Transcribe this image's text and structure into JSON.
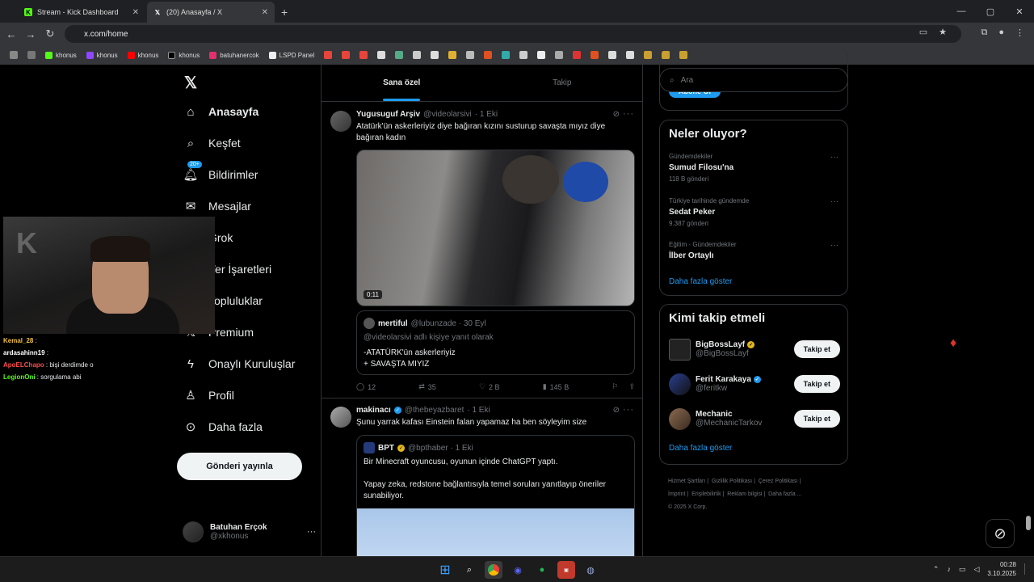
{
  "browser": {
    "tabs": [
      {
        "title": "Stream - Kick Dashboard",
        "icon": "kick-icon",
        "active": false
      },
      {
        "title": "(20) Anasayfa / X",
        "icon": "x-icon",
        "active": true
      }
    ],
    "url": "x.com/home",
    "bookmarks": [
      "khonus",
      "khonus",
      "khonus",
      "khonus",
      "batuhanercok",
      "LSPD Panel"
    ]
  },
  "leftnav": {
    "items": [
      "Anasayfa",
      "Keşfet",
      "Bildirimler",
      "Mesajlar",
      "Grok",
      "Yer İşaretleri",
      "Topluluklar",
      "Premium",
      "Onaylı Kuruluşlar",
      "Profil",
      "Daha fazla"
    ],
    "notif_badge": "20+",
    "post_button": "Gönderi yayınla",
    "me_name": "Batuhan Erçok",
    "me_handle": "@xkhonus"
  },
  "chat": [
    {
      "user": "Kemal_28",
      "msg": ":",
      "color": "#f0c040"
    },
    {
      "user": "ardasahinn19",
      "msg": ":",
      "color": "#ffffff"
    },
    {
      "user": "ApoELChapo",
      "msg": ": bişi derdimde o",
      "color": "#ff4d4d"
    },
    {
      "user": "LegionOni",
      "msg": ": sorgulama abi",
      "color": "#53fc18"
    }
  ],
  "feed": {
    "tabs": [
      "Sana özel",
      "Takip"
    ],
    "tweets": [
      {
        "name": "Yugusuguf Arşiv",
        "handle": "@videolarsivi",
        "time": "· 1 Eki",
        "text": "Atatürk'ün askerleriyiz diye bağıran kızını susturup savaşta mıyız diye bağıran kadın",
        "duration": "0:11",
        "quote": {
          "name": "mertiful",
          "handle": "@lubunzade · 30 Eyl",
          "reply_to": "@videolarsivi adlı kişiye yanıt olarak",
          "line1": "-ATATÜRK'ün askerleriyiz",
          "line2": "+ SAVAŞTA MIYIZ"
        },
        "stats": {
          "replies": "12",
          "reposts": "35",
          "likes": "2 B",
          "views": "145 B"
        }
      },
      {
        "name": "makinacı",
        "handle": "@thebeyazbaret",
        "time": "· 1 Eki",
        "text": "Şunu yarrak kafası Einstein falan yapamaz ha ben söyleyim size",
        "quote": {
          "name": "BPT",
          "handle": "@bpthaber · 1 Eki",
          "line1": "Bir Minecraft oyuncusu, oyunun içinde ChatGPT yaptı.",
          "line2": "Yapay zeka, redstone bağlantısıyla temel soruları yanıtlayıp öneriler sunabiliyor."
        }
      }
    ]
  },
  "right": {
    "search_placeholder": "Ara",
    "subscribe": "Abone Ol",
    "trends_title": "Neler oluyor?",
    "trends": [
      {
        "context": "Gündemdekiler",
        "title": "Sumud Filosu'na",
        "posts": "118 B gönderi"
      },
      {
        "context": "Türkiye tarihinde gündemde",
        "title": "Sedat Peker",
        "posts": "9.387 gönderi"
      },
      {
        "context": "Eğitim · Gündemdekiler",
        "title": "İlber Ortaylı",
        "posts": ""
      }
    ],
    "show_more": "Daha fazla göster",
    "who_title": "Kimi takip etmeli",
    "who": [
      {
        "name": "BigBossLayf",
        "handle": "@BigBossLayf",
        "badge": "gold"
      },
      {
        "name": "Ferit Karakaya",
        "handle": "@feritkw",
        "badge": "blue"
      },
      {
        "name": "Mechanic",
        "handle": "@MechanicTarkov",
        "badge": ""
      }
    ],
    "follow": "Takip et",
    "footer": [
      "Hizmet Şartları",
      "Gizlilik Politikası",
      "Çerez Politikası",
      "İmprint",
      "Erişilebilirlik",
      "Reklam bilgisi",
      "Daha fazla ...",
      "© 2025 X Corp."
    ]
  },
  "taskbar": {
    "time": "00:28",
    "date": "3.10.2025"
  }
}
